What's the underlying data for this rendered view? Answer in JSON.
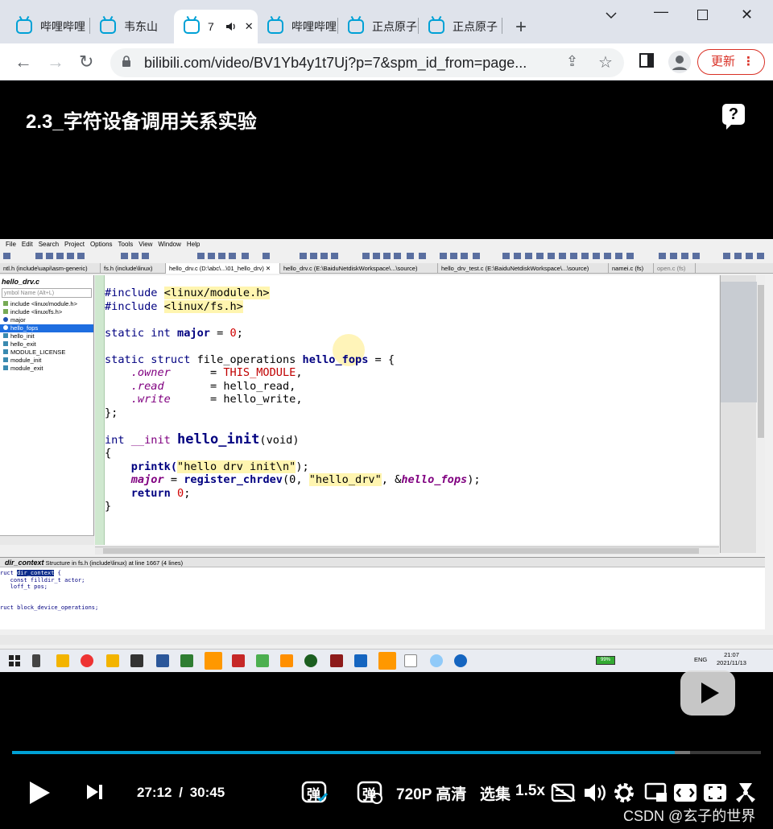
{
  "browser": {
    "tabs": [
      {
        "label": "哔哩哔哩",
        "active": false
      },
      {
        "label": "韦东山",
        "active": false
      },
      {
        "label": "7",
        "active": true
      },
      {
        "label": "哔哩哔哩",
        "active": false
      },
      {
        "label": "正点原子",
        "active": false
      },
      {
        "label": "正点原子",
        "active": false
      }
    ],
    "url": "bilibili.com/video/BV1Yb4y1t7Uj?p=7&spm_id_from=page...",
    "update_label": "更新"
  },
  "video": {
    "title": "2.3_字符设备调用关系实验",
    "help_symbol": "?"
  },
  "ide": {
    "menu": [
      "File",
      "Edit",
      "Search",
      "Project",
      "Options",
      "Tools",
      "View",
      "Window",
      "Help"
    ],
    "file_tabs": [
      {
        "label": "ntl.h (include\\uapi\\asm-generic)",
        "active": false
      },
      {
        "label": "fs.h (include\\linux)",
        "active": false
      },
      {
        "label": "hello_drv.c (D:\\abc\\...\\01_hello_drv) ✕",
        "active": true
      },
      {
        "label": "hello_drv.c (E:\\BaiduNetdiskWorkspace\\...\\source)",
        "active": false
      },
      {
        "label": "hello_drv_test.c (E:\\BaiduNetdiskWorkspace\\...\\source)",
        "active": false
      },
      {
        "label": "namei.c (fs)",
        "active": false
      },
      {
        "label": "open.c (fs)",
        "active": false
      }
    ],
    "symbol_pane": {
      "title": "hello_drv.c",
      "search_placeholder": "ymbol Name (Alt+L)",
      "items": [
        {
          "label": "include <linux/module.h>",
          "selected": false
        },
        {
          "label": "include <linux/fs.h>",
          "selected": false
        },
        {
          "label": "major",
          "selected": false
        },
        {
          "label": "hello_fops",
          "selected": true
        },
        {
          "label": "hello_init",
          "selected": false
        },
        {
          "label": "hello_exit",
          "selected": false
        },
        {
          "label": "MODULE_LICENSE",
          "selected": false
        },
        {
          "label": "module_init",
          "selected": false
        },
        {
          "label": "module_exit",
          "selected": false
        }
      ]
    },
    "code": {
      "l1_kw": "#include ",
      "l1_hdr": "<linux/module.h>",
      "l2_kw": "#include ",
      "l2_hdr": "<linux/fs.h>",
      "l3_a": "static int ",
      "l3_b": "major",
      "l3_c": " = ",
      "l3_d": "0",
      "l3_e": ";",
      "l4_a": "static struct ",
      "l4_b": "file_operations ",
      "l4_c": "hello_fops",
      "l4_d": " = {",
      "l5_a": "    .owner",
      "l5_b": "      = ",
      "l5_c": "THIS_MODULE",
      "l5_d": ",",
      "l6_a": "    .read",
      "l6_b": "       = hello_read,",
      "l7_a": "    .write",
      "l7_b": "      = hello_write,",
      "l8": "};",
      "l9_a": "int ",
      "l9_b": "__init ",
      "l9_c": "hello_init",
      "l9_d": "(void)",
      "l10": "{",
      "l11_a": "    printk(",
      "l11_b": "\"hello drv init\\n\"",
      "l11_c": ");",
      "l12_a": "    major",
      "l12_b": " = ",
      "l12_c": "register_chrdev",
      "l12_d": "(0, ",
      "l12_e": "\"hello_drv\"",
      "l12_f": ", &",
      "l12_g": "hello_fops",
      "l12_h": ");",
      "l13_a": "    return ",
      "l13_b": "0",
      "l13_c": ";",
      "l14": "}"
    },
    "context": {
      "title": "dir_context",
      "subtitle": "Structure in fs.h (include\\linux) at line 1667 (4 lines)",
      "lines": [
        "ruct ",
        "dir_context",
        " {",
        "   const filldir_t actor;",
        "   loff_t pos;",
        "",
        "",
        "ruct block_device_operations;"
      ]
    },
    "tray": {
      "battery": "99%",
      "lang": "ENG",
      "time": "21:07",
      "date": "2021/11/13"
    }
  },
  "player": {
    "current_time": "27:12",
    "separator": "/",
    "total_time": "30:45",
    "played_fraction": 0.885,
    "quality": "720P 高清",
    "episodes": "选集",
    "speed": "1.5x",
    "danmaku_label": "弹",
    "watermark": "CSDN @玄子的世界"
  }
}
